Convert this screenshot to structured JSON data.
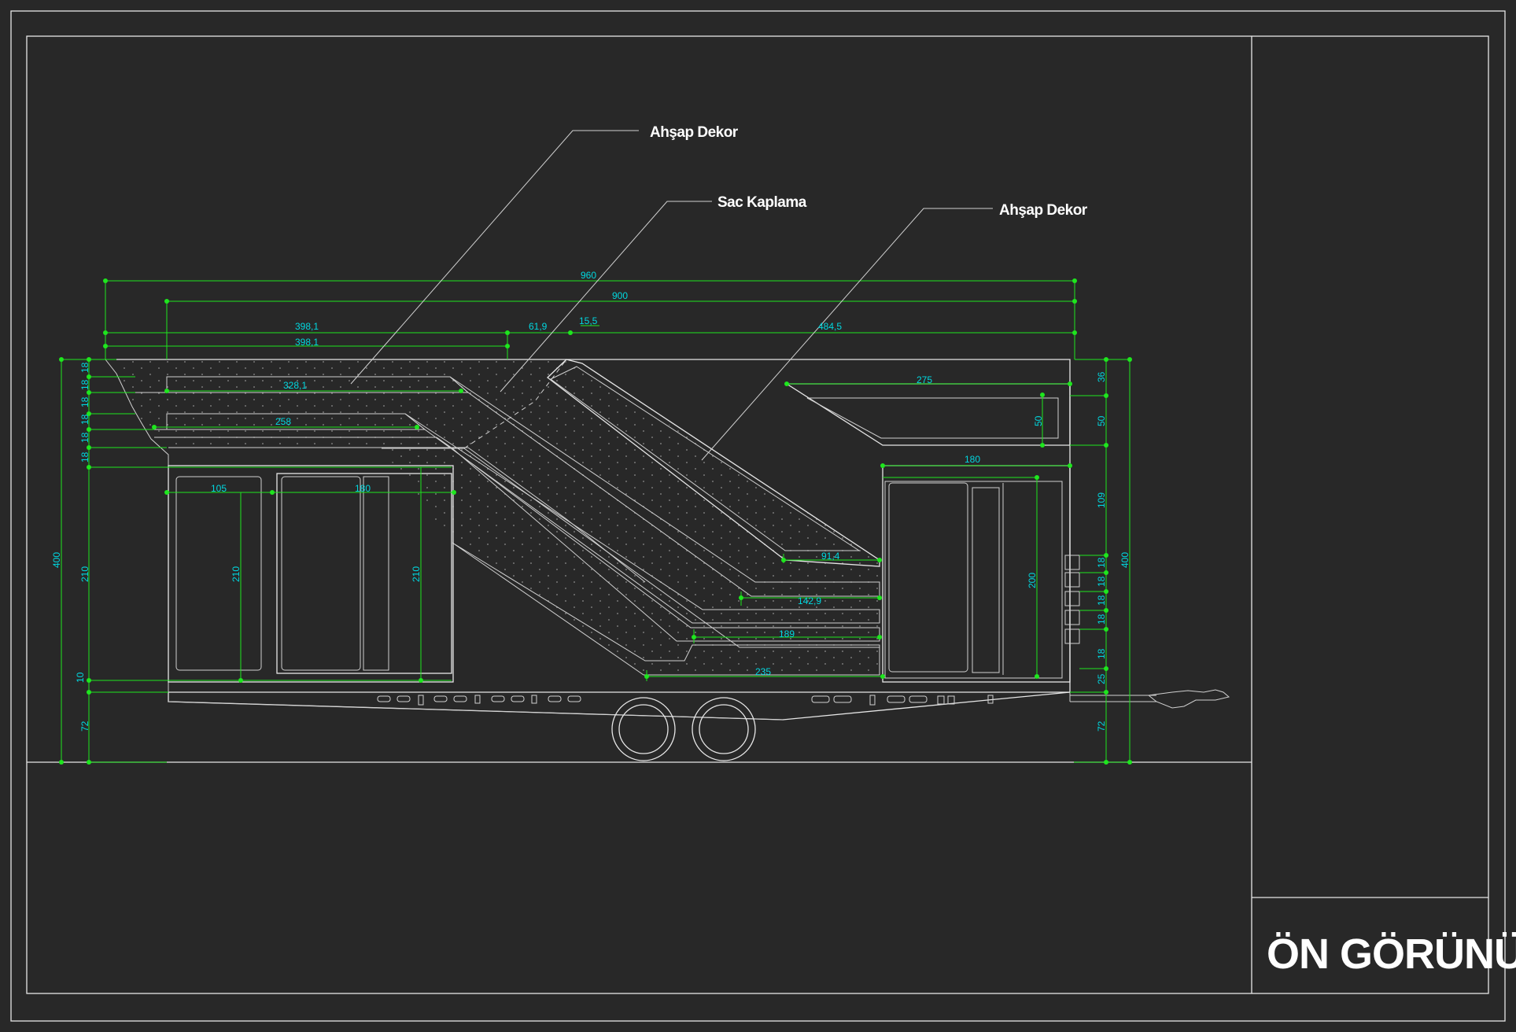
{
  "title": "ÖN GÖRÜNÜŞ",
  "notes": {
    "ahsap_dekor_1": "Ahşap Dekor",
    "sac_kaplama": "Sac Kaplama",
    "ahsap_dekor_2": "Ahşap Dekor"
  },
  "dimensions": {
    "d960": "960",
    "d900": "900",
    "d398a": "398,1",
    "d398b": "398,1",
    "d61": "61,9",
    "d15": "15,5",
    "d484": "484,5",
    "d328": "328,1",
    "d258": "258",
    "d275": "275",
    "d50a": "50",
    "d180a": "180",
    "d105": "105",
    "d180b": "180",
    "d210a": "210",
    "d210b": "210",
    "d210c": "210",
    "d400l": "400",
    "d10": "10",
    "d72l": "72",
    "d18_1": "18",
    "d18_2": "18",
    "d18_3": "18",
    "d18_4": "18",
    "d18_5": "18",
    "d18_6": "18",
    "d91": "91,4",
    "d142": "142,9",
    "d189": "189",
    "d235": "235",
    "d200": "200",
    "d36": "36",
    "d50b": "50",
    "d109": "109",
    "d18r1": "18",
    "d18r2": "18",
    "d18r3": "18",
    "d18r4": "18",
    "d18r5": "18",
    "d25": "25",
    "d72r": "72",
    "d400r": "400"
  },
  "colors": {
    "background": "#282828",
    "frame": "#e6e6e6",
    "dimension_line": "#1ee61e",
    "dimension_text": "#00d8e0",
    "panel_fill": "#2b2f4a"
  }
}
